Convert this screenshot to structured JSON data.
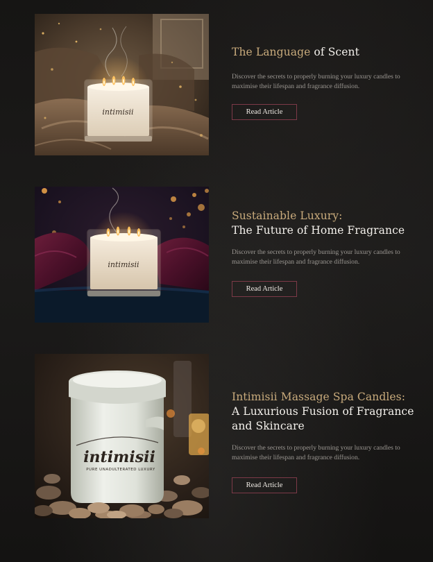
{
  "articles": [
    {
      "title_accent": "The Language",
      "title_white": " of Scent",
      "title_line2": "",
      "title_line3": "",
      "description": "Discover the secrets to properly burning your luxury candles to maximise their lifespan and fragrance diffusion.",
      "button_label": "Read Article",
      "image_scene": "four-wick-candle-on-velvet"
    },
    {
      "title_accent": "Sustainable Luxury:",
      "title_white": "",
      "title_line2": "The Future of  Home Fragrance",
      "title_line3": "",
      "description": "Discover the secrets to properly burning your luxury candles to maximise their lifespan and fragrance diffusion.",
      "button_label": "Read Article",
      "image_scene": "four-wick-candle-on-burgundy-silk"
    },
    {
      "title_accent": "Intimisii Massage Spa Candles:",
      "title_white": "",
      "title_line2": "A Luxurious Fusion of Fragrance",
      "title_line3": "and Skincare",
      "description": "Discover the secrets to properly burning your luxury candles to maximise their lifespan and fragrance diffusion.",
      "button_label": "Read Article",
      "image_scene": "ceramic-massage-candle-on-pebbles"
    }
  ],
  "image_brand_text": {
    "candle_label": "intimisii",
    "massage_candle_label": "intimisii",
    "massage_candle_tagline": "PURE UNADULTERATED LUXURY"
  },
  "colors": {
    "accent_gold": "#c9ab7c",
    "button_border": "#7d3a48",
    "body_text": "#9c9893",
    "background": "#1a1918"
  }
}
